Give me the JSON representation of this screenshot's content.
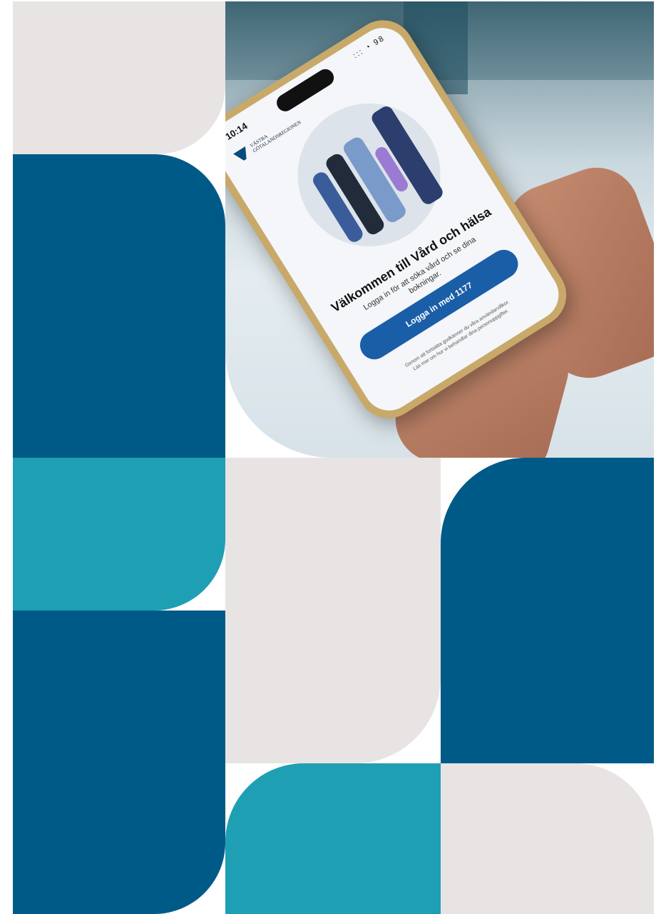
{
  "colors": {
    "light_gray": "#e8e4e3",
    "dark_blue": "#005a87",
    "teal": "#1f9fb3",
    "white": "#ffffff",
    "button_blue": "#1a5ea8"
  },
  "phone_screen": {
    "time": "10:14",
    "status_icons": "::: ◔ 98",
    "brand_name": "VÄSTRA GÖTALANDSREGIONEN",
    "welcome_title": "Välkommen till Vård och hälsa",
    "subtitle": "Logga in för att söka vård och se dina bokningar.",
    "login_button": "Logga in med 1177",
    "terms_text": "Genom att fortsätta godkänner du våra användarvillkor.",
    "privacy_text": "Läs mer om hur vi behandlar dina personuppgifter."
  }
}
